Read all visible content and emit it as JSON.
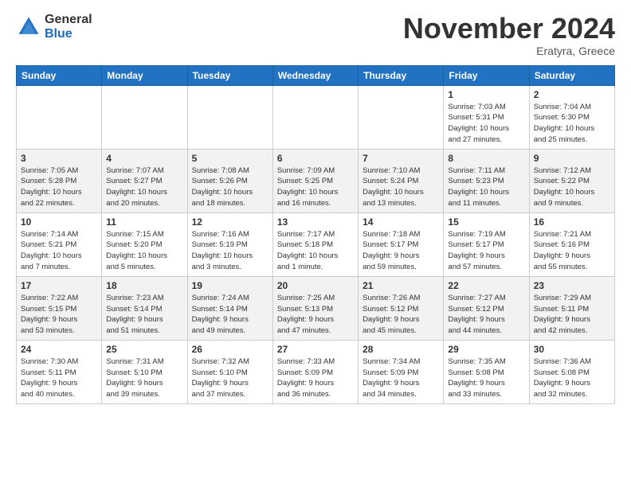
{
  "logo": {
    "general": "General",
    "blue": "Blue"
  },
  "header": {
    "month": "November 2024",
    "location": "Eratyra, Greece"
  },
  "days_of_week": [
    "Sunday",
    "Monday",
    "Tuesday",
    "Wednesday",
    "Thursday",
    "Friday",
    "Saturday"
  ],
  "weeks": [
    [
      {
        "day": "",
        "info": ""
      },
      {
        "day": "",
        "info": ""
      },
      {
        "day": "",
        "info": ""
      },
      {
        "day": "",
        "info": ""
      },
      {
        "day": "",
        "info": ""
      },
      {
        "day": "1",
        "info": "Sunrise: 7:03 AM\nSunset: 5:31 PM\nDaylight: 10 hours\nand 27 minutes."
      },
      {
        "day": "2",
        "info": "Sunrise: 7:04 AM\nSunset: 5:30 PM\nDaylight: 10 hours\nand 25 minutes."
      }
    ],
    [
      {
        "day": "3",
        "info": "Sunrise: 7:05 AM\nSunset: 5:28 PM\nDaylight: 10 hours\nand 22 minutes."
      },
      {
        "day": "4",
        "info": "Sunrise: 7:07 AM\nSunset: 5:27 PM\nDaylight: 10 hours\nand 20 minutes."
      },
      {
        "day": "5",
        "info": "Sunrise: 7:08 AM\nSunset: 5:26 PM\nDaylight: 10 hours\nand 18 minutes."
      },
      {
        "day": "6",
        "info": "Sunrise: 7:09 AM\nSunset: 5:25 PM\nDaylight: 10 hours\nand 16 minutes."
      },
      {
        "day": "7",
        "info": "Sunrise: 7:10 AM\nSunset: 5:24 PM\nDaylight: 10 hours\nand 13 minutes."
      },
      {
        "day": "8",
        "info": "Sunrise: 7:11 AM\nSunset: 5:23 PM\nDaylight: 10 hours\nand 11 minutes."
      },
      {
        "day": "9",
        "info": "Sunrise: 7:12 AM\nSunset: 5:22 PM\nDaylight: 10 hours\nand 9 minutes."
      }
    ],
    [
      {
        "day": "10",
        "info": "Sunrise: 7:14 AM\nSunset: 5:21 PM\nDaylight: 10 hours\nand 7 minutes."
      },
      {
        "day": "11",
        "info": "Sunrise: 7:15 AM\nSunset: 5:20 PM\nDaylight: 10 hours\nand 5 minutes."
      },
      {
        "day": "12",
        "info": "Sunrise: 7:16 AM\nSunset: 5:19 PM\nDaylight: 10 hours\nand 3 minutes."
      },
      {
        "day": "13",
        "info": "Sunrise: 7:17 AM\nSunset: 5:18 PM\nDaylight: 10 hours\nand 1 minute."
      },
      {
        "day": "14",
        "info": "Sunrise: 7:18 AM\nSunset: 5:17 PM\nDaylight: 9 hours\nand 59 minutes."
      },
      {
        "day": "15",
        "info": "Sunrise: 7:19 AM\nSunset: 5:17 PM\nDaylight: 9 hours\nand 57 minutes."
      },
      {
        "day": "16",
        "info": "Sunrise: 7:21 AM\nSunset: 5:16 PM\nDaylight: 9 hours\nand 55 minutes."
      }
    ],
    [
      {
        "day": "17",
        "info": "Sunrise: 7:22 AM\nSunset: 5:15 PM\nDaylight: 9 hours\nand 53 minutes."
      },
      {
        "day": "18",
        "info": "Sunrise: 7:23 AM\nSunset: 5:14 PM\nDaylight: 9 hours\nand 51 minutes."
      },
      {
        "day": "19",
        "info": "Sunrise: 7:24 AM\nSunset: 5:14 PM\nDaylight: 9 hours\nand 49 minutes."
      },
      {
        "day": "20",
        "info": "Sunrise: 7:25 AM\nSunset: 5:13 PM\nDaylight: 9 hours\nand 47 minutes."
      },
      {
        "day": "21",
        "info": "Sunrise: 7:26 AM\nSunset: 5:12 PM\nDaylight: 9 hours\nand 45 minutes."
      },
      {
        "day": "22",
        "info": "Sunrise: 7:27 AM\nSunset: 5:12 PM\nDaylight: 9 hours\nand 44 minutes."
      },
      {
        "day": "23",
        "info": "Sunrise: 7:29 AM\nSunset: 5:11 PM\nDaylight: 9 hours\nand 42 minutes."
      }
    ],
    [
      {
        "day": "24",
        "info": "Sunrise: 7:30 AM\nSunset: 5:11 PM\nDaylight: 9 hours\nand 40 minutes."
      },
      {
        "day": "25",
        "info": "Sunrise: 7:31 AM\nSunset: 5:10 PM\nDaylight: 9 hours\nand 39 minutes."
      },
      {
        "day": "26",
        "info": "Sunrise: 7:32 AM\nSunset: 5:10 PM\nDaylight: 9 hours\nand 37 minutes."
      },
      {
        "day": "27",
        "info": "Sunrise: 7:33 AM\nSunset: 5:09 PM\nDaylight: 9 hours\nand 36 minutes."
      },
      {
        "day": "28",
        "info": "Sunrise: 7:34 AM\nSunset: 5:09 PM\nDaylight: 9 hours\nand 34 minutes."
      },
      {
        "day": "29",
        "info": "Sunrise: 7:35 AM\nSunset: 5:08 PM\nDaylight: 9 hours\nand 33 minutes."
      },
      {
        "day": "30",
        "info": "Sunrise: 7:36 AM\nSunset: 5:08 PM\nDaylight: 9 hours\nand 32 minutes."
      }
    ]
  ]
}
